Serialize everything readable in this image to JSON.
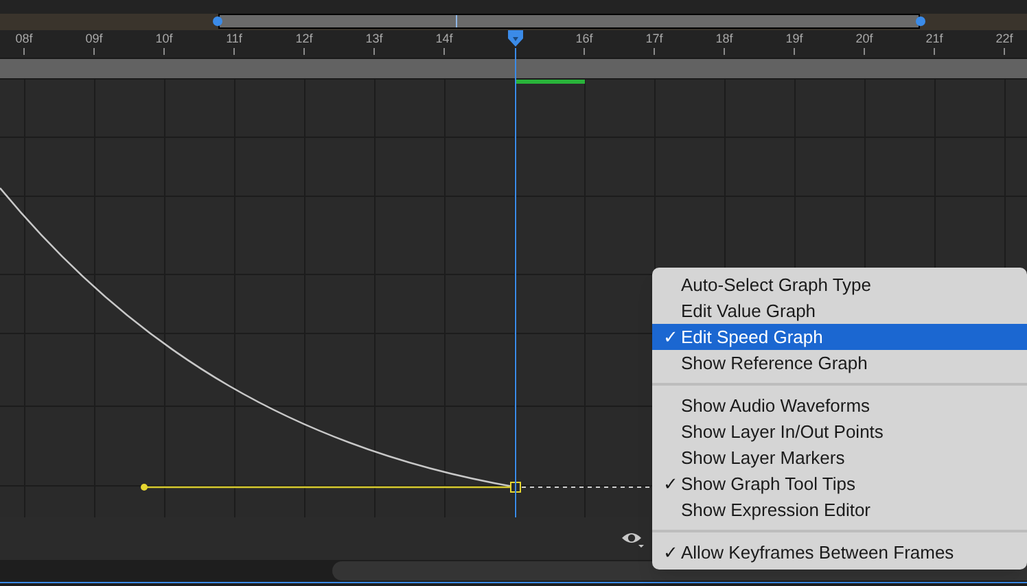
{
  "navigator": {
    "level": 0.683
  },
  "ruler": {
    "labels_before_playhead": [
      "08f",
      "09f",
      "10f",
      "11f",
      "12f",
      "13f",
      "14f"
    ],
    "labels_after_playhead": [
      "16f",
      "17f",
      "18f",
      "19f",
      "20f",
      "21f",
      "22f"
    ]
  },
  "context_menu": {
    "items": [
      {
        "kind": "item",
        "label": "Auto-Select Graph Type",
        "selected": false
      },
      {
        "kind": "item",
        "label": "Edit Value Graph",
        "selected": false
      },
      {
        "kind": "item",
        "check_mark": "✓",
        "label": "Edit Speed Graph",
        "selected": true
      },
      {
        "kind": "item",
        "label": "Show Reference Graph",
        "selected": false
      },
      {
        "kind": "separator"
      },
      {
        "kind": "item",
        "label": "Show Audio Waveforms",
        "selected": false
      },
      {
        "kind": "item",
        "label": "Show Layer In/Out Points",
        "selected": false
      },
      {
        "kind": "item",
        "label": "Show Layer Markers",
        "selected": false
      },
      {
        "kind": "item",
        "check_mark": "✓",
        "label": "Show Graph Tool Tips",
        "selected": false
      },
      {
        "kind": "item",
        "label": "Show Expression Editor",
        "selected": false
      },
      {
        "kind": "separator"
      },
      {
        "kind": "item",
        "check_mark": "✓",
        "label": "Allow Keyframes Between Frames",
        "selected": false
      }
    ]
  }
}
